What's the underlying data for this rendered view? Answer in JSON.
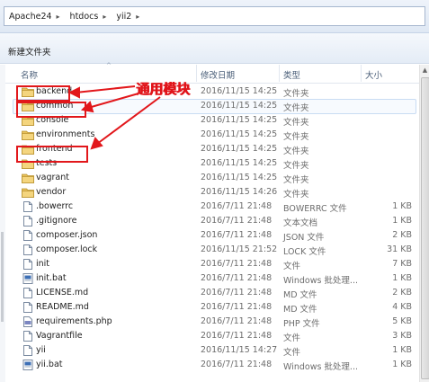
{
  "breadcrumb": [
    "Apache24",
    "htdocs",
    "yii2"
  ],
  "toolbar": {
    "new_folder": "新建文件夹"
  },
  "columns": {
    "name": "名称",
    "date": "修改日期",
    "type": "类型",
    "size": "大小"
  },
  "annotation": "通用模块",
  "colors": {
    "annotation": "#e2171b",
    "folder": "#e8c15a",
    "selection": "#c9dcf3"
  },
  "files": [
    {
      "name": "backend",
      "date": "2016/11/15 14:25",
      "type": "文件夹",
      "size": "",
      "icon": "folder-icon"
    },
    {
      "name": "common",
      "date": "2016/11/15 14:25",
      "type": "文件夹",
      "size": "",
      "icon": "folder-icon"
    },
    {
      "name": "console",
      "date": "2016/11/15 14:25",
      "type": "文件夹",
      "size": "",
      "icon": "folder-icon"
    },
    {
      "name": "environments",
      "date": "2016/11/15 14:25",
      "type": "文件夹",
      "size": "",
      "icon": "folder-icon"
    },
    {
      "name": "frontend",
      "date": "2016/11/15 14:25",
      "type": "文件夹",
      "size": "",
      "icon": "folder-icon"
    },
    {
      "name": "tests",
      "date": "2016/11/15 14:25",
      "type": "文件夹",
      "size": "",
      "icon": "folder-icon"
    },
    {
      "name": "vagrant",
      "date": "2016/11/15 14:25",
      "type": "文件夹",
      "size": "",
      "icon": "folder-icon"
    },
    {
      "name": "vendor",
      "date": "2016/11/15 14:26",
      "type": "文件夹",
      "size": "",
      "icon": "folder-icon"
    },
    {
      "name": ".bowerrc",
      "date": "2016/7/11 21:48",
      "type": "BOWERRC 文件",
      "size": "1 KB",
      "icon": "file-icon"
    },
    {
      "name": ".gitignore",
      "date": "2016/7/11 21:48",
      "type": "文本文档",
      "size": "1 KB",
      "icon": "file-icon"
    },
    {
      "name": "composer.json",
      "date": "2016/7/11 21:48",
      "type": "JSON 文件",
      "size": "2 KB",
      "icon": "file-icon"
    },
    {
      "name": "composer.lock",
      "date": "2016/11/15 21:52",
      "type": "LOCK 文件",
      "size": "31 KB",
      "icon": "file-icon"
    },
    {
      "name": "init",
      "date": "2016/7/11 21:48",
      "type": "文件",
      "size": "7 KB",
      "icon": "file-icon"
    },
    {
      "name": "init.bat",
      "date": "2016/7/11 21:48",
      "type": "Windows 批处理...",
      "size": "1 KB",
      "icon": "batch-file-icon"
    },
    {
      "name": "LICENSE.md",
      "date": "2016/7/11 21:48",
      "type": "MD 文件",
      "size": "2 KB",
      "icon": "file-icon"
    },
    {
      "name": "README.md",
      "date": "2016/7/11 21:48",
      "type": "MD 文件",
      "size": "4 KB",
      "icon": "file-icon"
    },
    {
      "name": "requirements.php",
      "date": "2016/7/11 21:48",
      "type": "PHP 文件",
      "size": "5 KB",
      "icon": "php-file-icon"
    },
    {
      "name": "Vagrantfile",
      "date": "2016/7/11 21:48",
      "type": "文件",
      "size": "3 KB",
      "icon": "file-icon"
    },
    {
      "name": "yii",
      "date": "2016/11/15 14:27",
      "type": "文件",
      "size": "1 KB",
      "icon": "file-icon"
    },
    {
      "name": "yii.bat",
      "date": "2016/7/11 21:48",
      "type": "Windows 批处理...",
      "size": "1 KB",
      "icon": "batch-file-icon"
    }
  ]
}
